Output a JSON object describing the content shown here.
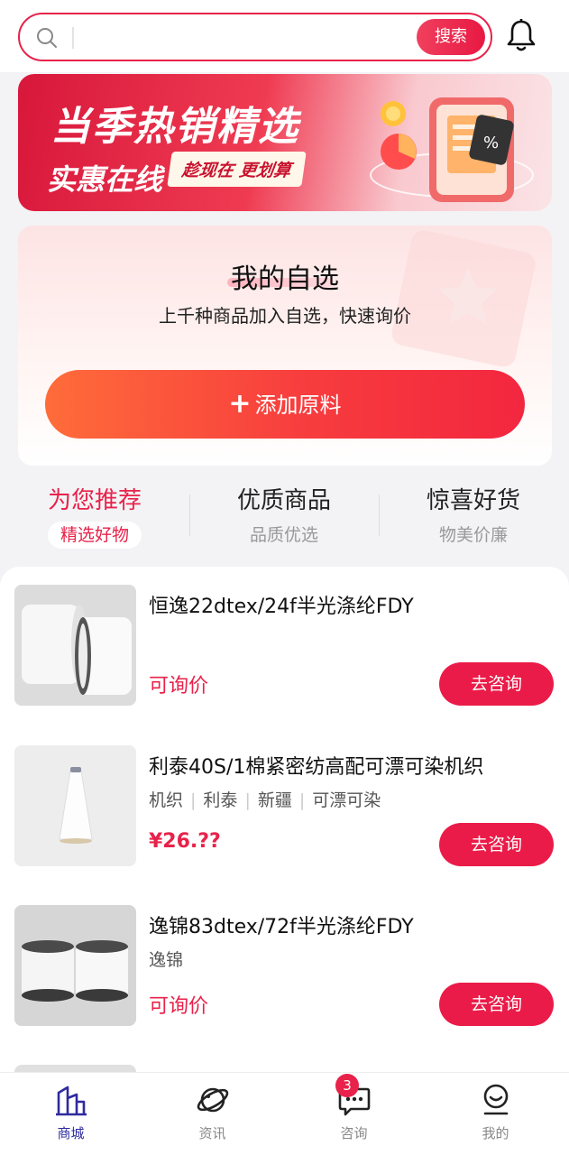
{
  "search": {
    "placeholder": "",
    "button_label": "搜索"
  },
  "banner": {
    "title": "当季热销精选",
    "subtitle": "实惠在线",
    "tag": "趁现在 更划算"
  },
  "favorites": {
    "title": "我的自选",
    "description": "上千种商品加入自选，快速询价",
    "button_label": "添加原料"
  },
  "tabs": [
    {
      "title": "为您推荐",
      "subtitle": "精选好物",
      "active": true
    },
    {
      "title": "优质商品",
      "subtitle": "品质优选",
      "active": false
    },
    {
      "title": "惊喜好货",
      "subtitle": "物美价廉",
      "active": false
    }
  ],
  "products": [
    {
      "name": "恒逸22dtex/24f半光涤纶FDY",
      "tags": [],
      "price": "可询价",
      "button_label": "去咨询",
      "image": "yarn-spools-white"
    },
    {
      "name": "利泰40S/1棉紧密纺高配可漂可染机织",
      "tags": [
        "机织",
        "利泰",
        "新疆",
        "可漂可染"
      ],
      "price": "¥26.??",
      "button_label": "去咨询",
      "image": "yarn-cone-white"
    },
    {
      "name": "逸锦83dtex/72f半光涤纶FDY",
      "tags": [
        "逸锦"
      ],
      "price": "可询价",
      "button_label": "去咨询",
      "image": "yarn-spools-dark-rim"
    }
  ],
  "bottom_nav": [
    {
      "label": "商城",
      "icon": "store-icon",
      "active": true
    },
    {
      "label": "资讯",
      "icon": "planet-icon",
      "active": false
    },
    {
      "label": "咨询",
      "icon": "chat-icon",
      "active": false,
      "badge": "3"
    },
    {
      "label": "我的",
      "icon": "profile-icon",
      "active": false
    }
  ],
  "colors": {
    "accent": "#e8224a",
    "nav_active": "#2f2a9e",
    "button_orange": "#ff6c3a"
  }
}
